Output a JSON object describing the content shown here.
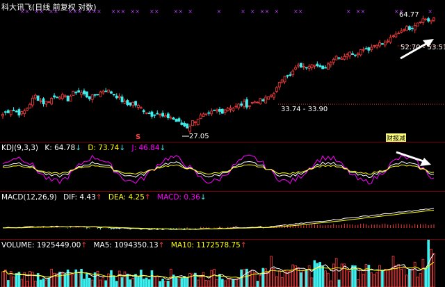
{
  "title": "科大讯飞(日线 前复权 对数)",
  "price_panel": {
    "labels": {
      "high": "64.77",
      "range_top": "52.70 - 53.51",
      "range_mid": "33.74 - 33.90",
      "low": "27.05",
      "event_tag": "财报减"
    }
  },
  "kdj": {
    "name": "KDJ(9,3,3)",
    "k": "K: 64.78",
    "d": "D: 73.74",
    "j": "J: 46.84"
  },
  "macd": {
    "name": "MACD(12,26,9)",
    "dif": "DIF: 4.43",
    "dea": "DEA: 4.25",
    "macd": "MACD: 0.36"
  },
  "volume": {
    "name": "VOLUME: 1925449.00",
    "ma5": "MA5: 1094350.13",
    "ma10": "MA10: 1172578.75"
  },
  "marker_s": "S",
  "colors": {
    "up": "#ff3c3c",
    "down": "#3cf0f0",
    "k_line": "#ffffff",
    "d_line": "#ffff00",
    "j_line": "#ff00ff",
    "separator": "#7a0000",
    "title": "#ffffff"
  },
  "chart_data": {
    "type": "candlestick",
    "y_scale": "log",
    "series_close": [
      30.5,
      31.2,
      31.8,
      31.0,
      30.6,
      31.5,
      33.5,
      35.2,
      34.0,
      33.2,
      34.1,
      34.8,
      35.5,
      35.0,
      34.2,
      35.8,
      36.5,
      36.0,
      35.2,
      34.6,
      35.5,
      36.2,
      37.0,
      36.4,
      35.6,
      34.8,
      33.6,
      32.8,
      33.4,
      32.6,
      31.8,
      31.2,
      30.4,
      31.0,
      30.2,
      29.6,
      30.0,
      29.2,
      28.5,
      28.0,
      27.6,
      28.8,
      29.6,
      30.2,
      30.0,
      30.8,
      31.5,
      31.0,
      31.8,
      32.4,
      32.0,
      32.8,
      33.2,
      32.6,
      33.5,
      34.0,
      33.8,
      34.6,
      35.5,
      37.0,
      39.5,
      42.0,
      41.0,
      43.5,
      44.5,
      43.8,
      44.8,
      45.6,
      44.2,
      43.0,
      44.8,
      46.5,
      48.0,
      47.2,
      48.5,
      49.2,
      48.6,
      50.0,
      51.2,
      50.6,
      52.0,
      53.0,
      52.5,
      54.0,
      55.5,
      57.0,
      58.5,
      60.0,
      59.2,
      61.5,
      63.0,
      64.5,
      62.8,
      64.0
    ]
  }
}
